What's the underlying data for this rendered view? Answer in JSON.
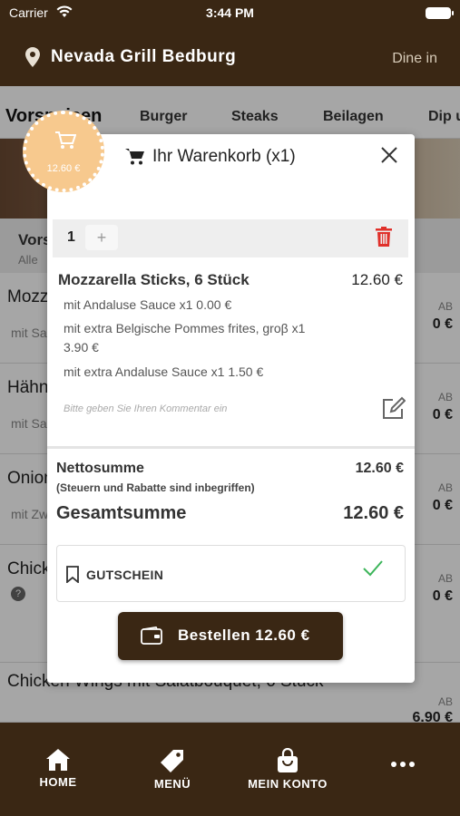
{
  "status_bar": {
    "carrier": "Carrier",
    "time": "3:44 PM"
  },
  "header": {
    "restaurant": "Nevada Grill Bedburg",
    "mode": "Dine in"
  },
  "categories": [
    "Vorspeisen",
    "Burger",
    "Steaks",
    "Beilagen",
    "Dip u"
  ],
  "section": {
    "title": "Vorspeisen",
    "subtitle": "Alle"
  },
  "menu_rows": [
    {
      "name": "Mozzarella Sticks",
      "sub": "mit Sauce",
      "ab": "AB",
      "price": "0 €"
    },
    {
      "name": "Hähnchen",
      "sub": "mit Sauce",
      "ab": "AB",
      "price": "0 €"
    },
    {
      "name": "Onion Rings",
      "sub": "mit Zwiebeln",
      "ab": "AB",
      "price": "0 €"
    },
    {
      "name": "Chicken Nuggets",
      "sub": "",
      "ab": "AB",
      "price": "0 €"
    },
    {
      "name": "Chicken Wings mit Salatbouquet, 6 Stück",
      "sub": "",
      "ab": "AB",
      "price": "6.90 €"
    }
  ],
  "cart_badge": {
    "price": "12.60 €"
  },
  "cart": {
    "title": "Ihr Warenkorb (x1)",
    "quantity": "1",
    "plus_label": "+",
    "item_name": "Mozzarella Sticks, 6 Stück",
    "item_price": "12.60 €",
    "options": [
      "mit Andaluse Sauce x1 0.00 €",
      "mit extra Belgische Pommes frites, groβ x1 3.90 €",
      "mit extra Andaluse Sauce x1 1.50 €"
    ],
    "comment_placeholder": "Bitte geben Sie Ihren Kommentar ein",
    "net_label": "Nettosumme",
    "net_value": "12.60 €",
    "tax_note": "(Steuern und Rabatte sind inbegriffen)",
    "total_label": "Gesamtsumme",
    "total_value": "12.60 €",
    "voucher_label": "GUTSCHEIN",
    "order_button": "Bestellen 12.60 €"
  },
  "bottom_nav": {
    "home": "HOME",
    "menu": "MENÜ",
    "account": "MEIN KONTO"
  },
  "colors": {
    "brand_dark": "#3a2714",
    "badge": "#f7c98e",
    "delete": "#e0302a",
    "check": "#3cb55a"
  }
}
